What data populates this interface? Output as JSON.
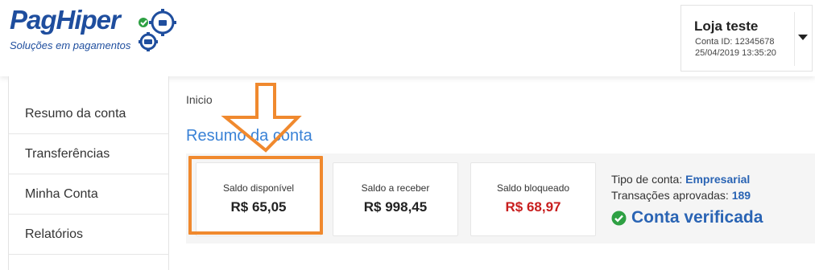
{
  "logo": {
    "brand": "PagHiper",
    "tagline": "Soluções em pagamentos"
  },
  "account": {
    "store_name": "Loja teste",
    "account_id": "Conta ID: 12345678",
    "datetime": "25/04/2019 13:35:20"
  },
  "sidebar": {
    "items": [
      {
        "label": "Resumo da conta"
      },
      {
        "label": "Transferências"
      },
      {
        "label": "Minha Conta"
      },
      {
        "label": "Relatórios"
      }
    ]
  },
  "main": {
    "breadcrumb": "Inicio",
    "title": "Resumo da conta",
    "cards": [
      {
        "label": "Saldo disponível",
        "value": "R$ 65,05",
        "color": "#222222"
      },
      {
        "label": "Saldo a receber",
        "value": "R$ 998,45",
        "color": "#222222"
      },
      {
        "label": "Saldo bloqueado",
        "value": "R$ 68,97",
        "color": "#c81e1e"
      }
    ],
    "info": {
      "account_type_label": "Tipo de conta:",
      "account_type_value": "Empresarial",
      "approved_label": "Transações aprovadas:",
      "approved_value": "189",
      "verified_text": "Conta verificada"
    }
  },
  "colors": {
    "brand_blue": "#1f4e9e",
    "title_blue": "#3a82d6",
    "highlight_orange": "#f0892e",
    "verified_green": "#2ea043"
  },
  "icons": [
    "gear-badge-icon",
    "chevron-down-icon",
    "check-circle-icon",
    "down-arrow-icon"
  ]
}
